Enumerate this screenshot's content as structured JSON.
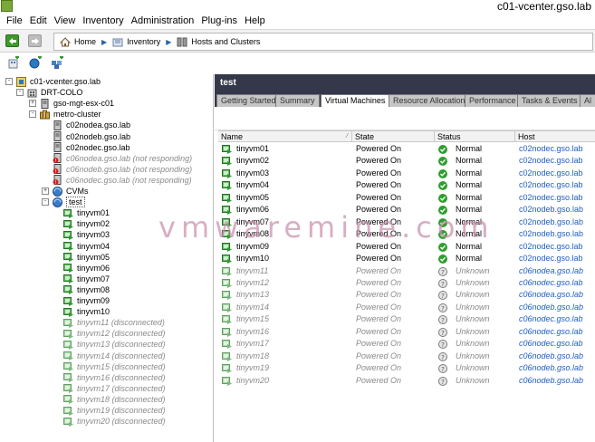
{
  "window": {
    "title": "c01-vcenter.gso.lab"
  },
  "menu": [
    "File",
    "Edit",
    "View",
    "Inventory",
    "Administration",
    "Plug-ins",
    "Help"
  ],
  "breadcrumb": {
    "home": "Home",
    "inventory": "Inventory",
    "current": "Hosts and Clusters"
  },
  "toolbar": {
    "icons": [
      "new-datacenter-icon",
      "new-vm-icon",
      "new-resource-pool-icon"
    ]
  },
  "tree": [
    {
      "label": "c01-vcenter.gso.lab",
      "icon": "vcenter-icon",
      "level": 0,
      "expander": "-",
      "state": "normal"
    },
    {
      "label": "DRT-COLO",
      "icon": "datacenter-icon",
      "level": 1,
      "expander": "-",
      "state": "normal"
    },
    {
      "label": "gso-mgt-esx-c01",
      "icon": "host-icon",
      "level": 2,
      "expander": "+",
      "state": "normal"
    },
    {
      "label": "metro-cluster",
      "icon": "cluster-icon",
      "level": 2,
      "expander": "-",
      "state": "normal"
    },
    {
      "label": "c02nodea.gso.lab",
      "icon": "host-icon",
      "level": 3,
      "expander": "",
      "state": "normal"
    },
    {
      "label": "c02nodeb.gso.lab",
      "icon": "host-icon",
      "level": 3,
      "expander": "",
      "state": "normal"
    },
    {
      "label": "c02nodec.gso.lab",
      "icon": "host-icon",
      "level": 3,
      "expander": "",
      "state": "normal"
    },
    {
      "label": "c06nodea.gso.lab (not responding)",
      "icon": "host-error-icon",
      "level": 3,
      "expander": "",
      "state": "dim"
    },
    {
      "label": "c06nodeb.gso.lab (not responding)",
      "icon": "host-error-icon",
      "level": 3,
      "expander": "",
      "state": "dim"
    },
    {
      "label": "c06nodec.gso.lab (not responding)",
      "icon": "host-error-icon",
      "level": 3,
      "expander": "",
      "state": "dim"
    },
    {
      "label": "CVMs",
      "icon": "resource-pool-icon",
      "level": 3,
      "expander": "+",
      "state": "normal"
    },
    {
      "label": "test",
      "icon": "resource-pool-icon",
      "level": 3,
      "expander": "-",
      "state": "selected"
    },
    {
      "label": "tinyvm01",
      "icon": "vm-on-icon",
      "level": 4,
      "expander": "",
      "state": "normal"
    },
    {
      "label": "tinyvm02",
      "icon": "vm-on-icon",
      "level": 4,
      "expander": "",
      "state": "normal"
    },
    {
      "label": "tinyvm03",
      "icon": "vm-on-icon",
      "level": 4,
      "expander": "",
      "state": "normal"
    },
    {
      "label": "tinyvm04",
      "icon": "vm-on-icon",
      "level": 4,
      "expander": "",
      "state": "normal"
    },
    {
      "label": "tinyvm05",
      "icon": "vm-on-icon",
      "level": 4,
      "expander": "",
      "state": "normal"
    },
    {
      "label": "tinyvm06",
      "icon": "vm-on-icon",
      "level": 4,
      "expander": "",
      "state": "normal"
    },
    {
      "label": "tinyvm07",
      "icon": "vm-on-icon",
      "level": 4,
      "expander": "",
      "state": "normal"
    },
    {
      "label": "tinyvm08",
      "icon": "vm-on-icon",
      "level": 4,
      "expander": "",
      "state": "normal"
    },
    {
      "label": "tinyvm09",
      "icon": "vm-on-icon",
      "level": 4,
      "expander": "",
      "state": "normal"
    },
    {
      "label": "tinyvm10",
      "icon": "vm-on-icon",
      "level": 4,
      "expander": "",
      "state": "normal"
    },
    {
      "label": "tinyvm11 (disconnected)",
      "icon": "vm-disconnected-icon",
      "level": 4,
      "expander": "",
      "state": "dim"
    },
    {
      "label": "tinyvm12 (disconnected)",
      "icon": "vm-disconnected-icon",
      "level": 4,
      "expander": "",
      "state": "dim"
    },
    {
      "label": "tinyvm13 (disconnected)",
      "icon": "vm-disconnected-icon",
      "level": 4,
      "expander": "",
      "state": "dim"
    },
    {
      "label": "tinyvm14 (disconnected)",
      "icon": "vm-disconnected-icon",
      "level": 4,
      "expander": "",
      "state": "dim"
    },
    {
      "label": "tinyvm15 (disconnected)",
      "icon": "vm-disconnected-icon",
      "level": 4,
      "expander": "",
      "state": "dim"
    },
    {
      "label": "tinyvm16 (disconnected)",
      "icon": "vm-disconnected-icon",
      "level": 4,
      "expander": "",
      "state": "dim"
    },
    {
      "label": "tinyvm17 (disconnected)",
      "icon": "vm-disconnected-icon",
      "level": 4,
      "expander": "",
      "state": "dim"
    },
    {
      "label": "tinyvm18 (disconnected)",
      "icon": "vm-disconnected-icon",
      "level": 4,
      "expander": "",
      "state": "dim"
    },
    {
      "label": "tinyvm19 (disconnected)",
      "icon": "vm-disconnected-icon",
      "level": 4,
      "expander": "",
      "state": "dim"
    },
    {
      "label": "tinyvm20 (disconnected)",
      "icon": "vm-disconnected-icon",
      "level": 4,
      "expander": "",
      "state": "dim"
    }
  ],
  "panel": {
    "title": "test",
    "tabs": [
      "Getting Started",
      "Summary",
      "Virtual Machines",
      "Resource Allocation",
      "Performance",
      "Tasks & Events",
      "Al"
    ],
    "active_tab": "Virtual Machines",
    "columns": [
      "Name",
      "State",
      "Status",
      "Host"
    ],
    "rows": [
      {
        "name": "tinyvm01",
        "state": "Powered On",
        "status": "Normal",
        "host": "c02nodec.gso.lab",
        "dim": false
      },
      {
        "name": "tinyvm02",
        "state": "Powered On",
        "status": "Normal",
        "host": "c02nodec.gso.lab",
        "dim": false
      },
      {
        "name": "tinyvm03",
        "state": "Powered On",
        "status": "Normal",
        "host": "c02nodec.gso.lab",
        "dim": false
      },
      {
        "name": "tinyvm04",
        "state": "Powered On",
        "status": "Normal",
        "host": "c02nodec.gso.lab",
        "dim": false
      },
      {
        "name": "tinyvm05",
        "state": "Powered On",
        "status": "Normal",
        "host": "c02nodec.gso.lab",
        "dim": false
      },
      {
        "name": "tinyvm06",
        "state": "Powered On",
        "status": "Normal",
        "host": "c02nodeb.gso.lab",
        "dim": false
      },
      {
        "name": "tinyvm07",
        "state": "Powered On",
        "status": "Normal",
        "host": "c02nodeb.gso.lab",
        "dim": false
      },
      {
        "name": "tinyvm08",
        "state": "Powered On",
        "status": "Normal",
        "host": "c02nodeb.gso.lab",
        "dim": false
      },
      {
        "name": "tinyvm09",
        "state": "Powered On",
        "status": "Normal",
        "host": "c02nodec.gso.lab",
        "dim": false
      },
      {
        "name": "tinyvm10",
        "state": "Powered On",
        "status": "Normal",
        "host": "c02nodec.gso.lab",
        "dim": false
      },
      {
        "name": "tinyvm11",
        "state": "Powered On",
        "status": "Unknown",
        "host": "c06nodea.gso.lab",
        "dim": true
      },
      {
        "name": "tinyvm12",
        "state": "Powered On",
        "status": "Unknown",
        "host": "c06nodec.gso.lab",
        "dim": true
      },
      {
        "name": "tinyvm13",
        "state": "Powered On",
        "status": "Unknown",
        "host": "c06nodea.gso.lab",
        "dim": true
      },
      {
        "name": "tinyvm14",
        "state": "Powered On",
        "status": "Unknown",
        "host": "c06nodeb.gso.lab",
        "dim": true
      },
      {
        "name": "tinyvm15",
        "state": "Powered On",
        "status": "Unknown",
        "host": "c06nodec.gso.lab",
        "dim": true
      },
      {
        "name": "tinyvm16",
        "state": "Powered On",
        "status": "Unknown",
        "host": "c06nodec.gso.lab",
        "dim": true
      },
      {
        "name": "tinyvm17",
        "state": "Powered On",
        "status": "Unknown",
        "host": "c06nodec.gso.lab",
        "dim": true
      },
      {
        "name": "tinyvm18",
        "state": "Powered On",
        "status": "Unknown",
        "host": "c06nodeb.gso.lab",
        "dim": true
      },
      {
        "name": "tinyvm19",
        "state": "Powered On",
        "status": "Unknown",
        "host": "c06nodeb.gso.lab",
        "dim": true
      },
      {
        "name": "tinyvm20",
        "state": "Powered On",
        "status": "Unknown",
        "host": "c06nodeb.gso.lab",
        "dim": true
      }
    ]
  },
  "watermark": "vmwaremine.com",
  "colors": {
    "panel_header": "#35384a",
    "status_normal": "#2e9e2e",
    "link": "#1f5fbf",
    "vm_icon": "#5cb85c"
  }
}
